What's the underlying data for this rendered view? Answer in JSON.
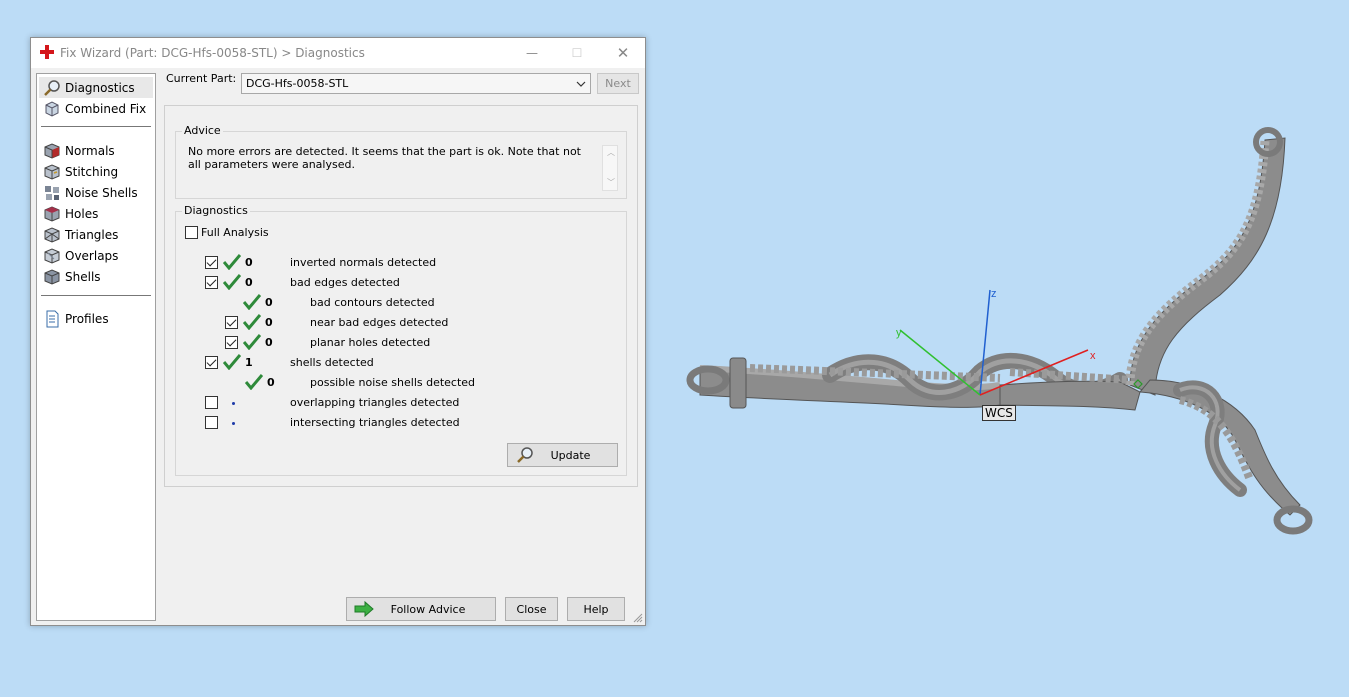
{
  "window": {
    "title": "Fix Wizard (Part: DCG-Hfs-0058-STL) > Diagnostics",
    "controls": {
      "minimize": "—",
      "maximize": "☐",
      "close": "✕"
    }
  },
  "sidebar": {
    "items": [
      {
        "label": "Diagnostics",
        "icon": "magnifier-icon",
        "selected": true
      },
      {
        "label": "Combined Fix",
        "icon": "cube-fix-icon"
      },
      {
        "label": "Normals",
        "icon": "normals-cube-icon"
      },
      {
        "label": "Stitching",
        "icon": "stitching-cube-icon"
      },
      {
        "label": "Noise Shells",
        "icon": "noise-shells-icon"
      },
      {
        "label": "Holes",
        "icon": "holes-cube-icon"
      },
      {
        "label": "Triangles",
        "icon": "triangles-cube-icon"
      },
      {
        "label": "Overlaps",
        "icon": "overlaps-cube-icon"
      },
      {
        "label": "Shells",
        "icon": "shells-cube-icon"
      },
      {
        "label": "Profiles",
        "icon": "profiles-document-icon"
      }
    ]
  },
  "current_part": {
    "label": "Current Part:",
    "value": "DCG-Hfs-0058-STL",
    "next_label": "Next"
  },
  "advice": {
    "title": "Advice",
    "text": "No more errors are detected. It seems that the part is ok. Note that not all parameters were analysed."
  },
  "diagnostics": {
    "title": "Diagnostics",
    "full_analysis_label": "Full Analysis",
    "full_analysis_checked": false,
    "rows": [
      {
        "checked": true,
        "status": "ok",
        "count": "0",
        "label": "inverted normals detected",
        "indent": 0,
        "has_checkbox": true
      },
      {
        "checked": true,
        "status": "ok",
        "count": "0",
        "label": "bad edges detected",
        "indent": 0,
        "has_checkbox": true
      },
      {
        "checked": false,
        "status": "ok",
        "count": "0",
        "label": "bad contours detected",
        "indent": 1,
        "has_checkbox": false
      },
      {
        "checked": true,
        "status": "ok",
        "count": "0",
        "label": "near bad edges detected",
        "indent": 1,
        "has_checkbox": true
      },
      {
        "checked": true,
        "status": "ok",
        "count": "0",
        "label": "planar holes detected",
        "indent": 1,
        "has_checkbox": true
      },
      {
        "checked": true,
        "status": "ok",
        "count": "1",
        "label": "shells detected",
        "indent": 0,
        "has_checkbox": true
      },
      {
        "checked": false,
        "status": "ok",
        "count": "0",
        "label": "possible noise shells detected",
        "indent": 1,
        "has_checkbox": false
      },
      {
        "checked": false,
        "status": "pending",
        "count": "",
        "label": "overlapping triangles detected",
        "indent": 0,
        "has_checkbox": true
      },
      {
        "checked": false,
        "status": "pending",
        "count": "",
        "label": "intersecting triangles detected",
        "indent": 0,
        "has_checkbox": true
      }
    ],
    "update_label": "Update"
  },
  "footer": {
    "follow_advice_label": "Follow Advice",
    "close_label": "Close",
    "help_label": "Help"
  },
  "viewport": {
    "axes": {
      "x": "x",
      "y": "y",
      "z": "z"
    },
    "wcs_label": "WCS",
    "colors": {
      "background": "#bcdcf6",
      "x_axis": "#e02020",
      "y_axis": "#30c030",
      "z_axis": "#2060d0",
      "model": "#8c8c8c"
    }
  }
}
